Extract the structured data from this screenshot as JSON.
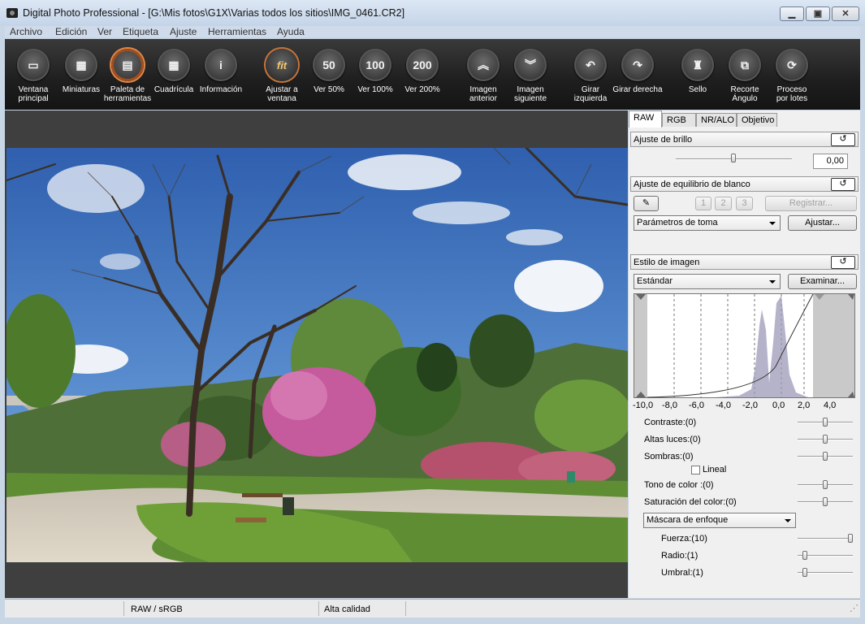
{
  "window": {
    "title": "Digital Photo Professional - [G:\\Mis fotos\\G1X\\Varias todos los sitios\\IMG_0461.CR2]",
    "min_glyph": "▁",
    "max_glyph": "▣",
    "close_glyph": "✕"
  },
  "menu": [
    "Archivo",
    "Edición",
    "Ver",
    "Etiqueta",
    "Ajuste",
    "Herramientas",
    "Ayuda"
  ],
  "toolbar": [
    {
      "label": "Ventana\nprincipal",
      "icon": "folder-icon",
      "glyph": "▭"
    },
    {
      "label": "Miniaturas",
      "icon": "thumbnails-icon",
      "glyph": "▦"
    },
    {
      "label": "Paleta de\nherramientas",
      "icon": "tool-palette-icon",
      "glyph": "▤"
    },
    {
      "label": "Cuadrícula",
      "icon": "grid-icon",
      "glyph": "▦"
    },
    {
      "label": "Información",
      "icon": "info-icon",
      "glyph": "i"
    },
    {
      "label": "Ajustar a\nventana",
      "icon": "fit-icon",
      "glyph": "fit"
    },
    {
      "label": "Ver 50%",
      "icon": "zoom-50-icon",
      "glyph": "50"
    },
    {
      "label": "Ver 100%",
      "icon": "zoom-100-icon",
      "glyph": "100"
    },
    {
      "label": "Ver 200%",
      "icon": "zoom-200-icon",
      "glyph": "200"
    },
    {
      "label": "Imagen\nanterior",
      "icon": "previous-image-icon",
      "glyph": "︽"
    },
    {
      "label": "Imagen\nsiguiente",
      "icon": "next-image-icon",
      "glyph": "︾"
    },
    {
      "label": "Girar izquierda",
      "icon": "rotate-left-icon",
      "glyph": "↶"
    },
    {
      "label": "Girar derecha",
      "icon": "rotate-right-icon",
      "glyph": "↷"
    },
    {
      "label": "Sello",
      "icon": "stamp-icon",
      "glyph": "♜"
    },
    {
      "label": "Recorte\nÁngulo",
      "icon": "crop-angle-icon",
      "glyph": "⧉"
    },
    {
      "label": "Proceso\npor lotes",
      "icon": "batch-process-icon",
      "glyph": "⟳"
    }
  ],
  "tabs": [
    "RAW",
    "RGB",
    "NR/ALO",
    "Objetivo"
  ],
  "brightness": {
    "title": "Ajuste de brillo",
    "value": "0,00",
    "reset_glyph": "↺",
    "level": 0.5
  },
  "white_balance": {
    "title": "Ajuste de equilibrio de blanco",
    "reset_glyph": "↺",
    "eyedropper_glyph": "✎",
    "presets": [
      "1",
      "2",
      "3"
    ],
    "register": "Registrar...",
    "selected": "Parámetros de toma",
    "adjust": "Ajustar..."
  },
  "picture_style": {
    "title": "Estilo de imagen",
    "reset_glyph": "↺",
    "selected": "Estándar",
    "browse": "Examinar...",
    "axis_ticks": [
      "-10,0",
      "-8,0",
      "-6,0",
      "-4,0",
      "-2,0",
      "0,0",
      "2,0",
      "4,0"
    ],
    "contrast": "Contraste:(0)",
    "highlights": "Altas luces:(0)",
    "shadows": "Sombras:(0)",
    "linear": "Lineal",
    "color_tone": "Tono de color :(0)",
    "saturation": "Saturación del color:(0)",
    "sharpness_mode": "Máscara de enfoque",
    "strength": "Fuerza:(10)",
    "radius": "Radio:(1)",
    "threshold": "Umbral:(1)"
  },
  "status": {
    "colorspace": "RAW / sRGB",
    "quality": "Alta calidad"
  }
}
